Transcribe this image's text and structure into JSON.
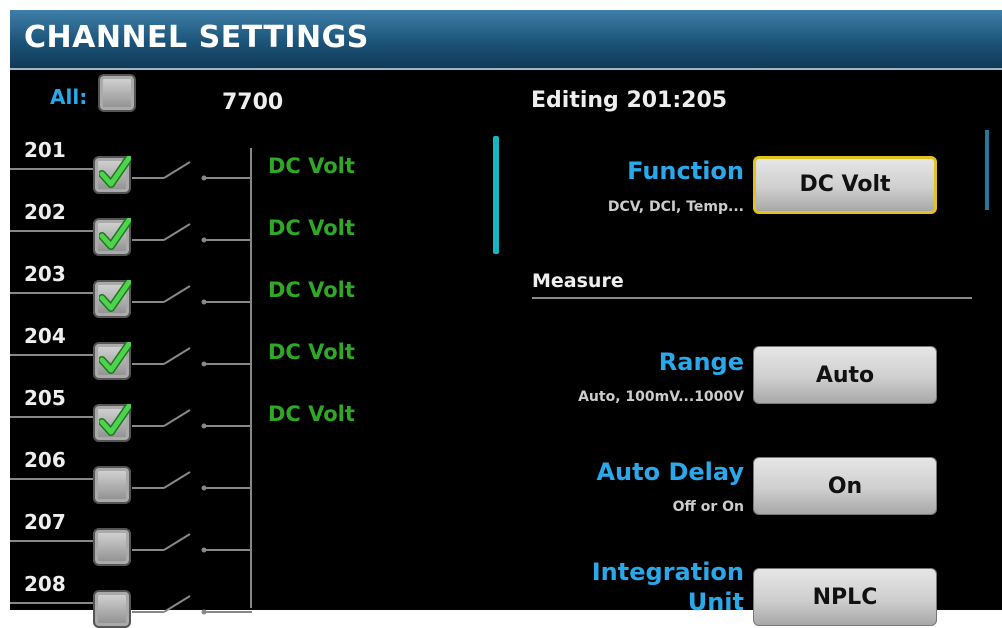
{
  "title": "CHANNEL SETTINGS",
  "header": {
    "all_label": "All:",
    "model": "7700",
    "editing": "Editing 201:205"
  },
  "channels": [
    {
      "num": "201",
      "checked": true,
      "function": "DC Volt"
    },
    {
      "num": "202",
      "checked": true,
      "function": "DC Volt"
    },
    {
      "num": "203",
      "checked": true,
      "function": "DC Volt"
    },
    {
      "num": "204",
      "checked": true,
      "function": "DC Volt"
    },
    {
      "num": "205",
      "checked": true,
      "function": "DC Volt"
    },
    {
      "num": "206",
      "checked": false,
      "function": ""
    },
    {
      "num": "207",
      "checked": false,
      "function": ""
    },
    {
      "num": "208",
      "checked": false,
      "function": ""
    }
  ],
  "settings": {
    "function": {
      "label": "Function",
      "sub": "DCV, DCI, Temp...",
      "value": "DC Volt"
    },
    "measure_section": "Measure",
    "range": {
      "label": "Range",
      "sub": "Auto, 100mV...1000V",
      "value": "Auto"
    },
    "auto_delay": {
      "label": "Auto Delay",
      "sub": "Off or On",
      "value": "On"
    },
    "integration_unit": {
      "label_line1": "Integration",
      "label_line2": "Unit",
      "value": "NPLC"
    }
  },
  "colors": {
    "accent_blue": "#29a8ea",
    "function_green": "#2fa826",
    "selected_border": "#e2c21c",
    "title_bar": "#1c5479"
  }
}
